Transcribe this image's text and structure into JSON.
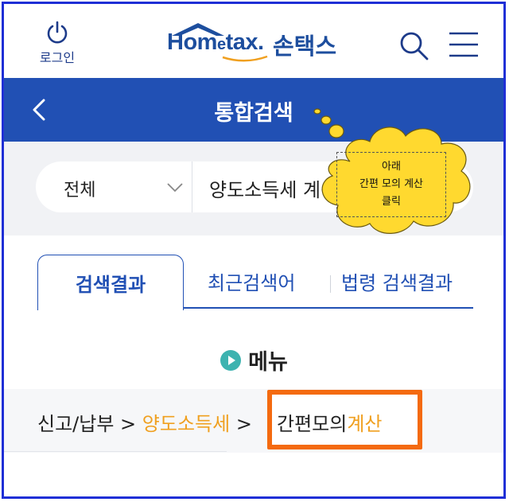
{
  "header": {
    "login_label": "로그인",
    "logo_text_a": "Hom",
    "logo_text_e": "e",
    "logo_text_b": "tax",
    "logo_text_dot": ".",
    "logo_korean": "손택스"
  },
  "titlebar": {
    "title": "통합검색"
  },
  "search": {
    "category": "전체",
    "query": "양도소득세 계산"
  },
  "callout": {
    "line1": "아래",
    "line2": "간편 모의 계산",
    "line3": "클릭"
  },
  "tabs": [
    {
      "label": "검색결과"
    },
    {
      "label": "최근검색어"
    },
    {
      "label": "법령 검색결과"
    }
  ],
  "menu": {
    "heading": "메뉴"
  },
  "result": {
    "crumb1": "신고/납부",
    "sep1": " > ",
    "crumb2": "양도소득세",
    "sep2": " > ",
    "crumb3_a": "간편모의",
    "crumb3_b": "계산"
  },
  "colors": {
    "brand_blue": "#2150b4",
    "highlight_orange": "#f46a10",
    "crumb_orange": "#f0a020",
    "cloud_yellow": "#ffd92f"
  }
}
